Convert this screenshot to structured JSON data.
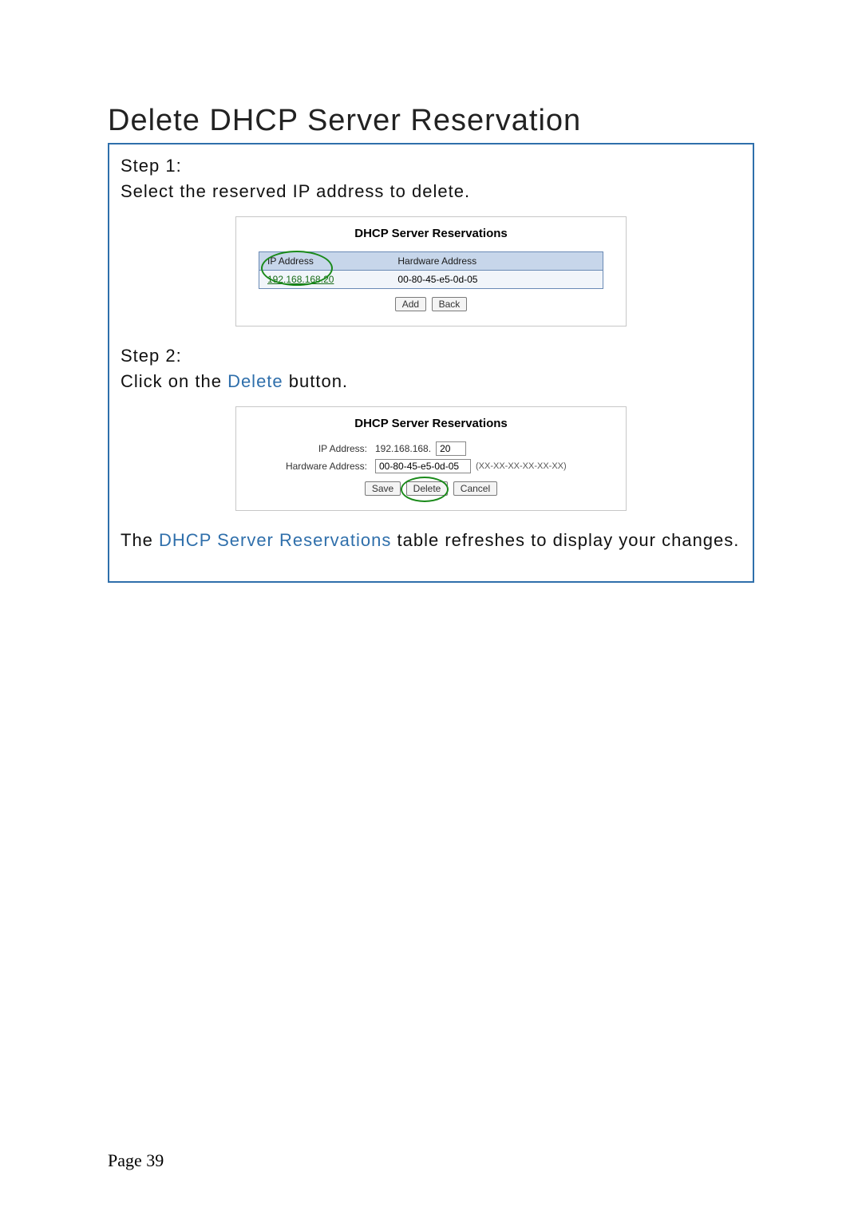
{
  "page": {
    "title": "Delete DHCP Server Reservation",
    "number": "Page 39"
  },
  "step1": {
    "label": "Step 1:",
    "text": "Select the reserved IP address to delete."
  },
  "shot1": {
    "title": "DHCP Server Reservations",
    "col_ip": "IP Address",
    "col_hw": "Hardware Address",
    "row_ip": "192.168.168.20",
    "row_hw": "00-80-45-e5-0d-05",
    "btn_add": "Add",
    "btn_back": "Back"
  },
  "step2": {
    "label": "Step 2:",
    "text_a": "Click on the ",
    "delete_word": "Delete",
    "text_b": " button."
  },
  "shot2": {
    "title": "DHCP Server Reservations",
    "lbl_ip": "IP Address:",
    "ip_prefix": "192.168.168.",
    "ip_last": "20",
    "lbl_hw": "Hardware Address:",
    "hw_val": "00-80-45-e5-0d-05",
    "hw_hint": "(XX-XX-XX-XX-XX-XX)",
    "btn_save": "Save",
    "btn_delete": "Delete",
    "btn_cancel": "Cancel"
  },
  "footer": {
    "a": "The ",
    "b": "DHCP Server Reservations",
    "c": " table refreshes to display your changes."
  }
}
